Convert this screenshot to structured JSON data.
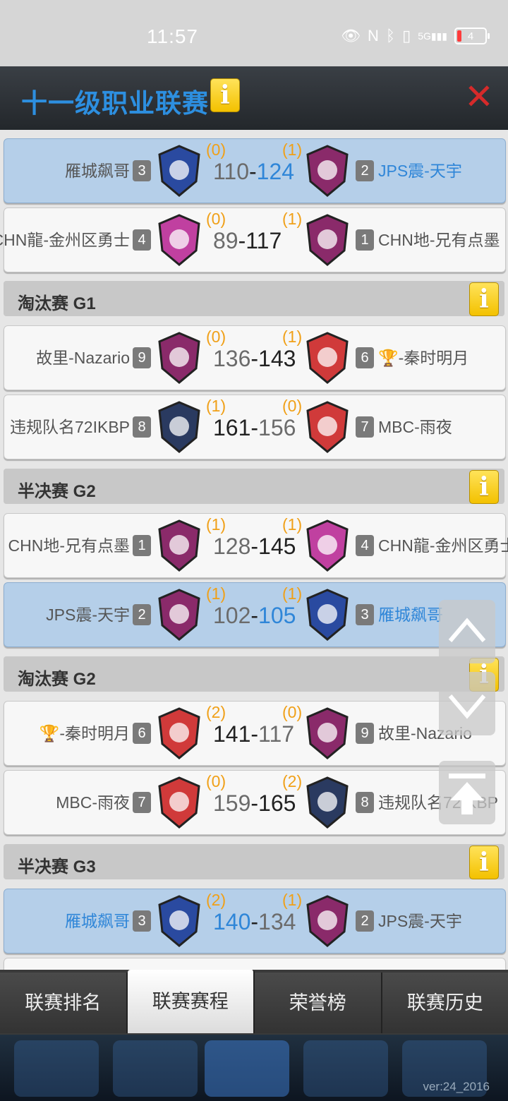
{
  "status": {
    "time": "11:57",
    "battery": "4"
  },
  "header": {
    "title": "十一级职业联赛",
    "info": "i",
    "close": "✕"
  },
  "matches": [
    {
      "left": "雁城飙哥",
      "left_seed": "3",
      "left_wins": "(0)",
      "score_l": "110",
      "score_r": "124",
      "right_wins": "(1)",
      "right_seed": "2",
      "right": "JPS震-天宇",
      "hl": true
    },
    {
      "left": "CHN龍-金州区勇士",
      "left_seed": "4",
      "left_wins": "(0)",
      "score_l": "89",
      "score_r": "117",
      "right_wins": "(1)",
      "right_seed": "1",
      "right": "CHN地-兄有点墨"
    },
    {
      "left": "故里-Nazario",
      "left_seed": "9",
      "left_wins": "(0)",
      "score_l": "136",
      "score_r": "143",
      "right_wins": "(1)",
      "right_seed": "6",
      "right": "🏆-秦时明月"
    },
    {
      "left": "违规队名72IKBP",
      "left_seed": "8",
      "left_wins": "(1)",
      "score_l": "161",
      "score_r": "156",
      "right_wins": "(0)",
      "right_seed": "7",
      "right": "MBC-雨夜"
    },
    {
      "left": "CHN地-兄有点墨",
      "left_seed": "1",
      "left_wins": "(1)",
      "score_l": "128",
      "score_r": "145",
      "right_wins": "(1)",
      "right_seed": "4",
      "right": "CHN龍-金州区勇士"
    },
    {
      "left": "JPS震-天宇",
      "left_seed": "2",
      "left_wins": "(1)",
      "score_l": "102",
      "score_r": "105",
      "right_wins": "(1)",
      "right_seed": "3",
      "right": "雁城飙哥",
      "hl": true
    },
    {
      "left": "🏆-秦时明月",
      "left_seed": "6",
      "left_wins": "(2)",
      "score_l": "141",
      "score_r": "117",
      "right_wins": "(0)",
      "right_seed": "9",
      "right": "故里-Nazario"
    },
    {
      "left": "MBC-雨夜",
      "left_seed": "7",
      "left_wins": "(0)",
      "score_l": "159",
      "score_r": "165",
      "right_wins": "(2)",
      "right_seed": "8",
      "right": "违规队名72IKBP"
    },
    {
      "left": "雁城飙哥",
      "left_seed": "3",
      "left_wins": "(2)",
      "score_l": "140",
      "score_r": "134",
      "right_wins": "(1)",
      "right_seed": "2",
      "right": "JPS震-天宇",
      "hl": true
    }
  ],
  "rounds": [
    "淘汰赛 G1",
    "半决赛 G2",
    "淘汰赛 G2",
    "半决赛 G3"
  ],
  "tabs": [
    "联赛排名",
    "联赛赛程",
    "荣誉榜",
    "联赛历史"
  ],
  "active_tab": "联赛赛程",
  "version": "ver:24_2016",
  "colors": {
    "blue_text": "#2f86d8",
    "wins_orange": "#f0a018",
    "highlight_row": "#b5cfe9",
    "close_red": "#d62a2a",
    "info_yellow": "#f3c100"
  }
}
